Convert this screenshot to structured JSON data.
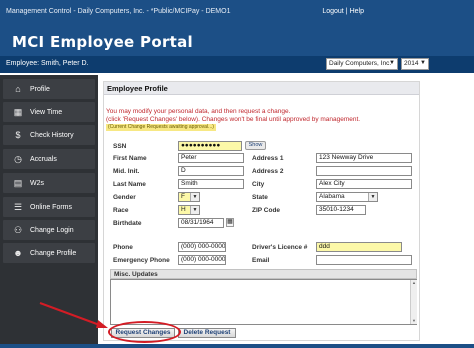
{
  "topbar": {
    "crumbs": "Management Control - Daily Computers, Inc. - *Public/MCIPay - DEMO1",
    "logout": "Logout",
    "separator": "|",
    "help": "Help"
  },
  "header": {
    "title": "MCI Employee Portal",
    "employee": "Employee: Smith, Peter D.",
    "company_select": "Daily Computers, Inc.",
    "year_select": "2014"
  },
  "sidebar": {
    "items": [
      {
        "label": "Profile",
        "icon": "home-icon"
      },
      {
        "label": "View Time",
        "icon": "calendar-icon"
      },
      {
        "label": "Check History",
        "icon": "money-bag-icon"
      },
      {
        "label": "Accruals",
        "icon": "clock-icon"
      },
      {
        "label": "W2s",
        "icon": "document-icon"
      },
      {
        "label": "Online Forms",
        "icon": "forms-icon"
      },
      {
        "label": "Change Login",
        "icon": "login-icon"
      },
      {
        "label": "Change Profile",
        "icon": "profile-icon"
      }
    ]
  },
  "profile": {
    "section_title": "Employee Profile",
    "message_line1": "You may modify your personal data, and then request a change.",
    "message_line2": "(click 'Request Changes' below). Changes won't be final until approved by management.",
    "pending_badge": "(Current Change Requests awaiting approval...)",
    "ssn_label": "SSN",
    "ssn_value": "●●●●●●●●●●",
    "show_label": "Show",
    "first_name_label": "First Name",
    "first_name": "Peter",
    "mid_init_label": "Mid. Init.",
    "mid_init": "D",
    "last_name_label": "Last Name",
    "last_name": "Smith",
    "gender_label": "Gender",
    "gender": "F",
    "race_label": "Race",
    "race": "H",
    "birthdate_label": "Birthdate",
    "birthdate": "08/31/1964",
    "address1_label": "Address 1",
    "address1": "123 Newway Drive",
    "address2_label": "Address 2",
    "address2": "",
    "city_label": "City",
    "city": "Alex City",
    "state_label": "State",
    "state": "Alabama",
    "zip_label": "ZIP Code",
    "zip": "35010-1234",
    "phone_label": "Phone",
    "phone": "(000) 000-0000",
    "emergency_phone_label": "Emergency Phone",
    "emergency_phone": "(000) 000-0000",
    "license_label": "Driver's Licence #",
    "license": "ddd",
    "email_label": "Email",
    "email": "",
    "misc_label": "Misc. Updates",
    "misc_value": "",
    "request_changes_label": "Request Changes",
    "delete_request_label": "Delete Request"
  },
  "colors": {
    "brand": "#1c4f86",
    "sidebar": "#2e3135",
    "alert_text": "#c0272d",
    "highlight_field": "#fcf8a8",
    "annotation": "#d31c25"
  }
}
